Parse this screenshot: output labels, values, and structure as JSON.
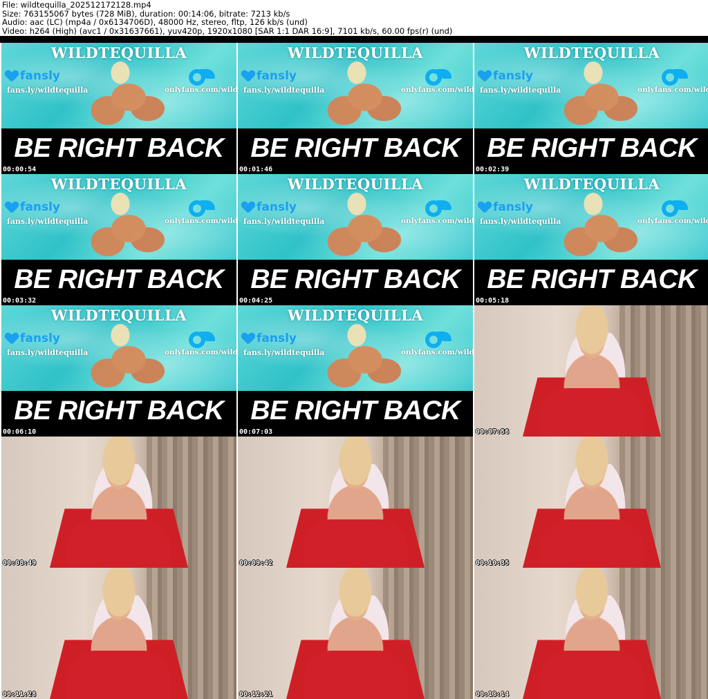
{
  "header": {
    "file_line": "File: wildtequilla_202512172128.mp4",
    "size_line": "Size: 763155067 bytes (728 MiB), duration: 00:14:06, bitrate: 7213 kb/s",
    "audio_line": "Audio: aac (LC) (mp4a / 0x6134706D), 48000 Hz, stereo, fltp, 126 kb/s (und)",
    "video_line": "Video: h264 (High) (avc1 / 0x31637661), yuv420p, 1920x1080 [SAR 1:1 DAR 16:9], 7101 kb/s, 60.00 fps(r) (und)"
  },
  "brb": {
    "brand": "WILDTEQUILLA",
    "fansly": "fansly",
    "fansly_url": "fans.ly/wildtequilla",
    "onlyfans_url": "onlyfans.com/wildtequilla",
    "banner": "BE RIGHT BACK"
  },
  "thumbnails": [
    {
      "time": "00:00:54",
      "kind": "brb"
    },
    {
      "time": "00:01:46",
      "kind": "brb"
    },
    {
      "time": "00:02:39",
      "kind": "brb"
    },
    {
      "time": "00:03:32",
      "kind": "brb"
    },
    {
      "time": "00:04:25",
      "kind": "brb"
    },
    {
      "time": "00:05:18",
      "kind": "brb"
    },
    {
      "time": "00:06:10",
      "kind": "brb"
    },
    {
      "time": "00:07:03",
      "kind": "brb"
    },
    {
      "time": "00:07:56",
      "kind": "cam"
    },
    {
      "time": "00:08:49",
      "kind": "cam"
    },
    {
      "time": "00:09:42",
      "kind": "cam"
    },
    {
      "time": "00:10:35",
      "kind": "cam"
    },
    {
      "time": "00:11:28",
      "kind": "cam"
    },
    {
      "time": "00:12:21",
      "kind": "cam"
    },
    {
      "time": "00:13:14",
      "kind": "cam"
    }
  ],
  "colors": {
    "pool": "#2fc2c8",
    "banner": "#000000",
    "fansly": "#1aa0f0",
    "onlyfans": "#0faef0",
    "dress": "#d1202a"
  }
}
